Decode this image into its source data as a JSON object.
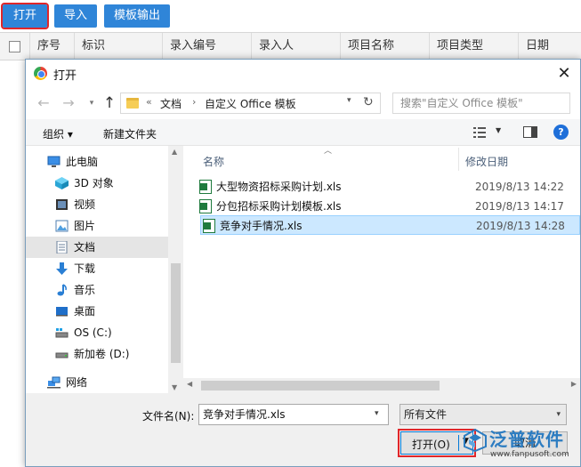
{
  "app": {
    "toolbar": {
      "open": "打开",
      "import": "导入",
      "export": "模板输出"
    },
    "columns": [
      "序号",
      "标识",
      "录入编号",
      "录入人",
      "项目名称",
      "项目类型",
      "日期"
    ]
  },
  "dialog": {
    "title": "打开",
    "close": "✕",
    "address": {
      "overflow": "«",
      "segments": [
        "文档",
        "自定义 Office 模板"
      ]
    },
    "search_placeholder": "搜索\"自定义 Office 模板\"",
    "commands": {
      "organize": "组织 ▾",
      "new_folder": "新建文件夹"
    },
    "nav_items": [
      {
        "label": "此电脑",
        "icon": "computer-icon"
      },
      {
        "label": "3D 对象",
        "icon": "cube-3d-icon"
      },
      {
        "label": "视频",
        "icon": "video-icon"
      },
      {
        "label": "图片",
        "icon": "picture-icon"
      },
      {
        "label": "文档",
        "icon": "document-icon",
        "selected": true
      },
      {
        "label": "下载",
        "icon": "download-icon"
      },
      {
        "label": "音乐",
        "icon": "music-icon"
      },
      {
        "label": "桌面",
        "icon": "desktop-icon"
      },
      {
        "label": "OS (C:)",
        "icon": "drive-c-icon"
      },
      {
        "label": "新加卷 (D:)",
        "icon": "drive-d-icon"
      },
      {
        "label": "网络",
        "icon": "network-icon"
      }
    ],
    "file_columns": {
      "name": "名称",
      "modified": "修改日期"
    },
    "files": [
      {
        "name": "大型物资招标采购计划.xls",
        "modified": "2019/8/13 14:22"
      },
      {
        "name": "分包招标采购计划模板.xls",
        "modified": "2019/8/13 14:17"
      },
      {
        "name": "竞争对手情况.xls",
        "modified": "2019/8/13 14:28",
        "selected": true
      }
    ],
    "filename_label": "文件名(N):",
    "filename_value": "竞争对手情况.xls",
    "file_type": "所有文件",
    "open_button": "打开(O)",
    "cancel_button": "取消"
  },
  "watermark": {
    "name": "泛普软件",
    "url": "www.fanpusoft.com"
  },
  "colors": {
    "accent": "#2f85d8",
    "highlight": "#e0262a",
    "selection": "#cce8ff"
  }
}
